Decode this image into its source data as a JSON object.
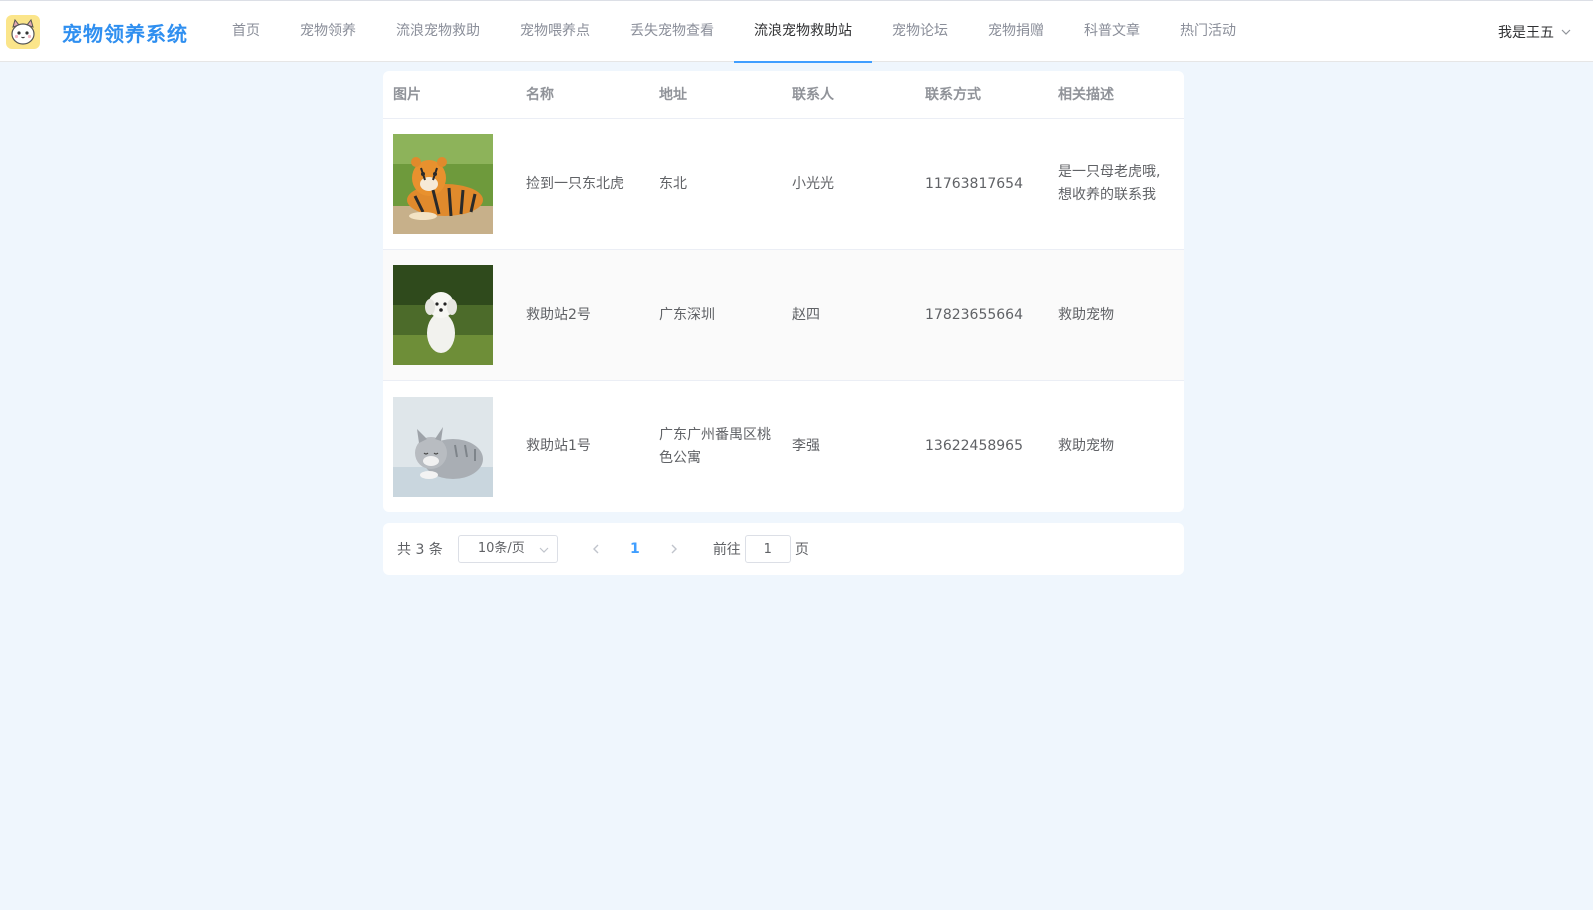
{
  "brand": {
    "name": "宠物领养系统",
    "icon": "pet-cat-icon"
  },
  "nav": {
    "items": [
      {
        "label": "首页"
      },
      {
        "label": "宠物领养"
      },
      {
        "label": "流浪宠物救助"
      },
      {
        "label": "宠物喂养点"
      },
      {
        "label": "丢失宠物查看"
      },
      {
        "label": "流浪宠物救助站",
        "active": true
      },
      {
        "label": "宠物论坛"
      },
      {
        "label": "宠物捐赠"
      },
      {
        "label": "科普文章"
      },
      {
        "label": "热门活动"
      }
    ]
  },
  "user": {
    "label": "我是王五",
    "icon": "chevron-down-icon"
  },
  "table": {
    "headers": [
      "图片",
      "名称",
      "地址",
      "联系人",
      "联系方式",
      "相关描述"
    ],
    "rows": [
      {
        "image": "tiger-photo",
        "name": "捡到一只东北虎",
        "address": "东北",
        "contact": "小光光",
        "phone": "11763817654",
        "desc_lines": [
          "是一只母老虎哦,",
          "想收养的联系我"
        ]
      },
      {
        "image": "white-puppy-photo",
        "name": "救助站2号",
        "address": "广东深圳",
        "contact": "赵四",
        "phone": "17823655664",
        "desc_lines": [
          "救助宠物"
        ]
      },
      {
        "image": "grey-kitten-photo",
        "name": "救助站1号",
        "address_lines": [
          "广东广州番禺区桃",
          "色公寓"
        ],
        "contact": "李强",
        "phone": "13622458965",
        "desc_lines": [
          "救助宠物"
        ]
      }
    ]
  },
  "pagination": {
    "total_text": "共 3 条",
    "page_size": "10条/页",
    "current_page": "1",
    "goto_label": "前往",
    "goto_value": "1",
    "page_suffix": "页"
  },
  "colors": {
    "accent": "#409eff",
    "brand": "#2f8ff0",
    "background": "#eff6fd"
  }
}
